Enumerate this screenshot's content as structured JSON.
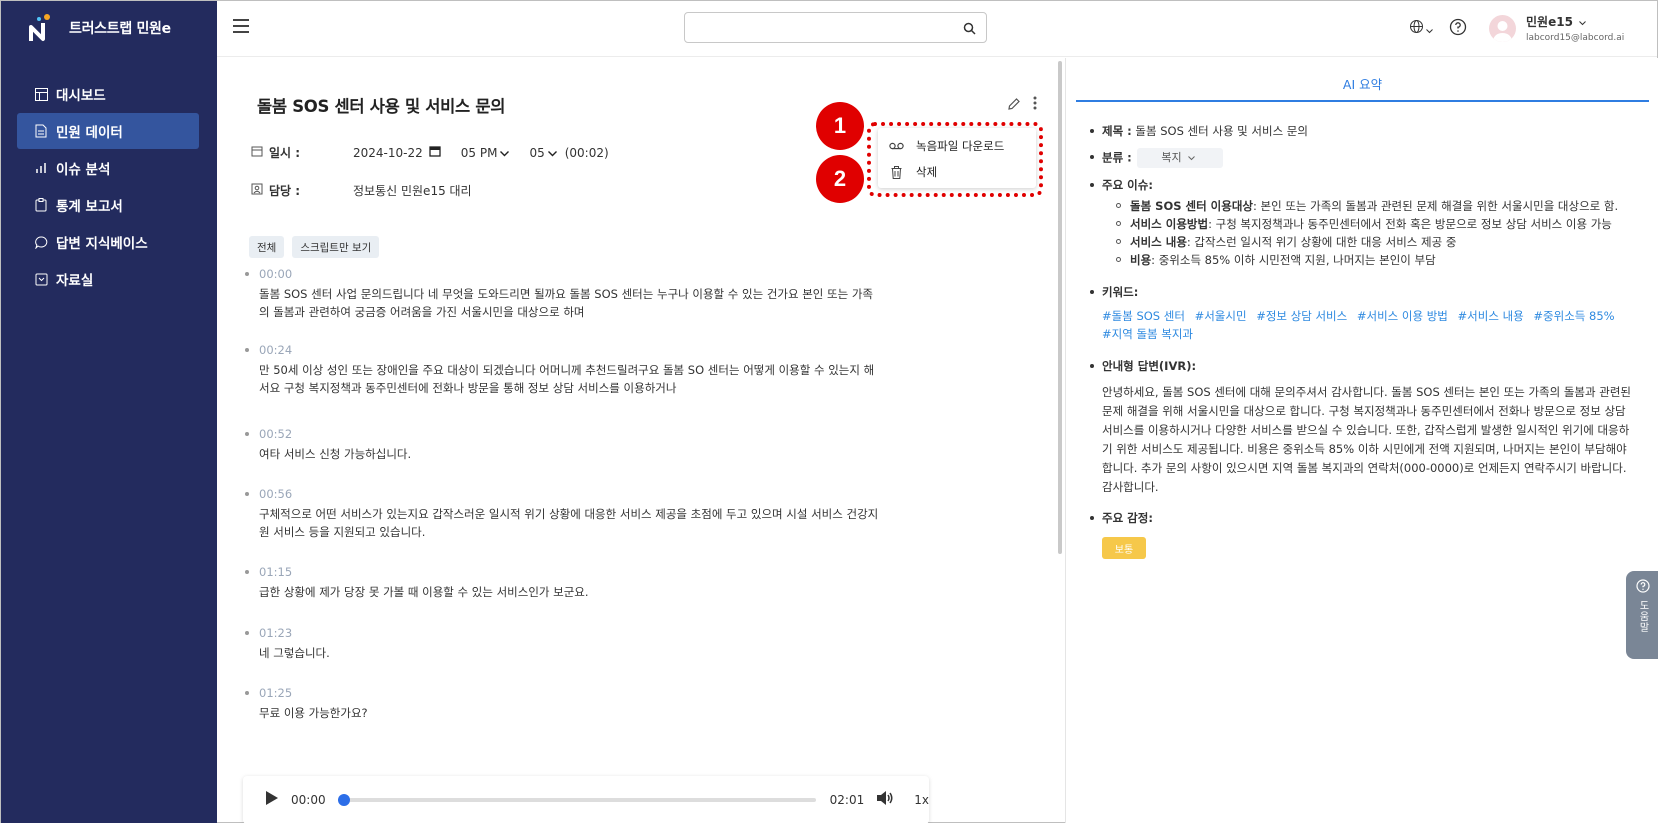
{
  "app": {
    "name": "트러스트랩 민원e"
  },
  "sidebar": {
    "items": [
      {
        "label": "대시보드",
        "icon": "dashboard-icon"
      },
      {
        "label": "민원 데이터",
        "icon": "document-icon",
        "active": true
      },
      {
        "label": "이슈 분석",
        "icon": "bar-chart-icon"
      },
      {
        "label": "통계 보고서",
        "icon": "clipboard-icon"
      },
      {
        "label": "답변 지식베이스",
        "icon": "chat-icon"
      },
      {
        "label": "자료실",
        "icon": "archive-icon"
      }
    ]
  },
  "header": {
    "search": {
      "value": "",
      "placeholder": ""
    },
    "user": {
      "name": "민원e15",
      "email": "labcord15@labcord.ai"
    }
  },
  "detail": {
    "title": "돌봄 SOS 센터 사용 및 서비스 문의",
    "datetime": {
      "label": "일시 :",
      "date": "2024-10-22",
      "hour": "05 PM",
      "minute": "05",
      "duration": "(00:02)"
    },
    "assignee": {
      "label": "담당 :",
      "value": "정보통신 민원e15 대리"
    },
    "filters": [
      "전체",
      "스크립트만 보기"
    ],
    "transcript": [
      {
        "time": "00:00",
        "text": "돌봄 SOS 센터 사업 문의드립니다 네 무엇을 도와드리면 될까요 돌봄 SOS 센터는 누구나 이용할 수 있는 건가요 본인 또는 가족의 돌봄과 관련하여 궁금증 어려움을 가진 서울시민을 대상으로 하며"
      },
      {
        "time": "00:24",
        "text": "만 50세 이상 성인 또는 장애인을 주요 대상이 되겠습니다 어머니께 추천드릴려구요 돌봄 SO 센터는 어떻게 이용할 수 있는지 해서요 구청 복지정책과 동주민센터에 전화나 방문을 통해 정보 상담 서비스를 이용하거나"
      },
      {
        "time": "00:52",
        "text": "여타 서비스 신청 가능하십니다."
      },
      {
        "time": "00:56",
        "text": "구체적으로 어떤 서비스가 있는지요 갑작스러운 일시적 위기 상황에 대응한 서비스 제공을 초점에 두고 있으며 시설 서비스 건강지원 서비스 등을 지원되고 있습니다."
      },
      {
        "time": "01:15",
        "text": "급한 상황에 제가 당장 못 가볼 때 이용할 수 있는 서비스인가 보군요."
      },
      {
        "time": "01:23",
        "text": "네 그렇습니다."
      },
      {
        "time": "01:25",
        "text": "무료 이용 가능한가요?"
      }
    ],
    "menu": {
      "download": "녹음파일 다운로드",
      "delete": "삭제"
    },
    "annotations": [
      "1",
      "2"
    ],
    "player": {
      "current": "00:00",
      "total": "02:01",
      "speed": "1x",
      "progress": 0
    }
  },
  "ai_summary": {
    "tab": "AI 요약",
    "title_label": "제목 :",
    "title_value": "돌봄 SOS 센터 사용 및 서비스 문의",
    "category_label": "분류 :",
    "category_value": "복지",
    "issues_label": "주요 이슈:",
    "issues": [
      {
        "key": "돌봄 SOS 센터 이용대상",
        "text": ": 본인 또는 가족의 돌봄과 관련된 문제 해결을 위한 서울시민을 대상으로 함."
      },
      {
        "key": "서비스 이용방법",
        "text": ": 구청 복지정책과나 동주민센터에서 전화 혹은 방문으로 정보 상담 서비스 이용 가능"
      },
      {
        "key": "서비스 내용",
        "text": ": 갑작스런 일시적 위기 상황에 대한 대응 서비스 제공 중"
      },
      {
        "key": "비용",
        "text": ": 중위소득 85% 이하 시민전액 지원, 나머지는 본인이 부담"
      }
    ],
    "keywords_label": "키워드:",
    "keywords": [
      "#돌봄 SOS 센터",
      "#서울시민",
      "#정보 상담 서비스",
      "#서비스 이용 방법",
      "#서비스 내용",
      "#중위소득 85%",
      "#지역 돌봄 복지과"
    ],
    "ivr_label": "안내형 답변(IVR):",
    "ivr_text": "안녕하세요, 돌봄 SOS 센터에 대해 문의주셔서 감사합니다. 돌봄 SOS 센터는 본인 또는 가족의 돌봄과 관련된 문제 해결을 위해 서울시민을 대상으로 합니다. 구청 복지정책과나 동주민센터에서 전화나 방문으로 정보 상담 서비스를 이용하시거나 다양한 서비스를 받으실 수 있습니다. 또한, 갑작스럽게 발생한 일시적인 위기에 대응하기 위한 서비스도 제공됩니다. 비용은 중위소득 85% 이하 시민에게 전액 지원되며, 나머지는 본인이 부담해야 합니다. 추가 문의 사항이 있으시면 지역 돌봄 복지과의 연락처(000-0000)로 언제든지 연락주시기 바랍니다. 감사합니다.",
    "emotion_label": "주요 감정:",
    "emotion_value": "보통"
  },
  "help": {
    "label": "도움말"
  },
  "colors": {
    "sidebar": "#232b5e",
    "active": "#34559e",
    "accent": "#2f7de1",
    "annotation": "#e00000",
    "emotion": "#f6c84a"
  }
}
